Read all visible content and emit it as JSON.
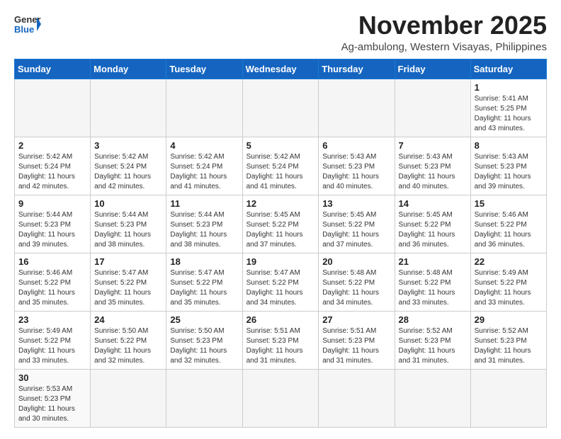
{
  "logo": {
    "text_general": "General",
    "text_blue": "Blue"
  },
  "header": {
    "month": "November 2025",
    "location": "Ag-ambulong, Western Visayas, Philippines"
  },
  "weekdays": [
    "Sunday",
    "Monday",
    "Tuesday",
    "Wednesday",
    "Thursday",
    "Friday",
    "Saturday"
  ],
  "weeks": [
    [
      {
        "day": null,
        "info": ""
      },
      {
        "day": null,
        "info": ""
      },
      {
        "day": null,
        "info": ""
      },
      {
        "day": null,
        "info": ""
      },
      {
        "day": null,
        "info": ""
      },
      {
        "day": null,
        "info": ""
      },
      {
        "day": "1",
        "info": "Sunrise: 5:41 AM\nSunset: 5:25 PM\nDaylight: 11 hours\nand 43 minutes."
      }
    ],
    [
      {
        "day": "2",
        "info": "Sunrise: 5:42 AM\nSunset: 5:24 PM\nDaylight: 11 hours\nand 42 minutes."
      },
      {
        "day": "3",
        "info": "Sunrise: 5:42 AM\nSunset: 5:24 PM\nDaylight: 11 hours\nand 42 minutes."
      },
      {
        "day": "4",
        "info": "Sunrise: 5:42 AM\nSunset: 5:24 PM\nDaylight: 11 hours\nand 41 minutes."
      },
      {
        "day": "5",
        "info": "Sunrise: 5:42 AM\nSunset: 5:24 PM\nDaylight: 11 hours\nand 41 minutes."
      },
      {
        "day": "6",
        "info": "Sunrise: 5:43 AM\nSunset: 5:23 PM\nDaylight: 11 hours\nand 40 minutes."
      },
      {
        "day": "7",
        "info": "Sunrise: 5:43 AM\nSunset: 5:23 PM\nDaylight: 11 hours\nand 40 minutes."
      },
      {
        "day": "8",
        "info": "Sunrise: 5:43 AM\nSunset: 5:23 PM\nDaylight: 11 hours\nand 39 minutes."
      }
    ],
    [
      {
        "day": "9",
        "info": "Sunrise: 5:44 AM\nSunset: 5:23 PM\nDaylight: 11 hours\nand 39 minutes."
      },
      {
        "day": "10",
        "info": "Sunrise: 5:44 AM\nSunset: 5:23 PM\nDaylight: 11 hours\nand 38 minutes."
      },
      {
        "day": "11",
        "info": "Sunrise: 5:44 AM\nSunset: 5:23 PM\nDaylight: 11 hours\nand 38 minutes."
      },
      {
        "day": "12",
        "info": "Sunrise: 5:45 AM\nSunset: 5:22 PM\nDaylight: 11 hours\nand 37 minutes."
      },
      {
        "day": "13",
        "info": "Sunrise: 5:45 AM\nSunset: 5:22 PM\nDaylight: 11 hours\nand 37 minutes."
      },
      {
        "day": "14",
        "info": "Sunrise: 5:45 AM\nSunset: 5:22 PM\nDaylight: 11 hours\nand 36 minutes."
      },
      {
        "day": "15",
        "info": "Sunrise: 5:46 AM\nSunset: 5:22 PM\nDaylight: 11 hours\nand 36 minutes."
      }
    ],
    [
      {
        "day": "16",
        "info": "Sunrise: 5:46 AM\nSunset: 5:22 PM\nDaylight: 11 hours\nand 35 minutes."
      },
      {
        "day": "17",
        "info": "Sunrise: 5:47 AM\nSunset: 5:22 PM\nDaylight: 11 hours\nand 35 minutes."
      },
      {
        "day": "18",
        "info": "Sunrise: 5:47 AM\nSunset: 5:22 PM\nDaylight: 11 hours\nand 35 minutes."
      },
      {
        "day": "19",
        "info": "Sunrise: 5:47 AM\nSunset: 5:22 PM\nDaylight: 11 hours\nand 34 minutes."
      },
      {
        "day": "20",
        "info": "Sunrise: 5:48 AM\nSunset: 5:22 PM\nDaylight: 11 hours\nand 34 minutes."
      },
      {
        "day": "21",
        "info": "Sunrise: 5:48 AM\nSunset: 5:22 PM\nDaylight: 11 hours\nand 33 minutes."
      },
      {
        "day": "22",
        "info": "Sunrise: 5:49 AM\nSunset: 5:22 PM\nDaylight: 11 hours\nand 33 minutes."
      }
    ],
    [
      {
        "day": "23",
        "info": "Sunrise: 5:49 AM\nSunset: 5:22 PM\nDaylight: 11 hours\nand 33 minutes."
      },
      {
        "day": "24",
        "info": "Sunrise: 5:50 AM\nSunset: 5:22 PM\nDaylight: 11 hours\nand 32 minutes."
      },
      {
        "day": "25",
        "info": "Sunrise: 5:50 AM\nSunset: 5:23 PM\nDaylight: 11 hours\nand 32 minutes."
      },
      {
        "day": "26",
        "info": "Sunrise: 5:51 AM\nSunset: 5:23 PM\nDaylight: 11 hours\nand 31 minutes."
      },
      {
        "day": "27",
        "info": "Sunrise: 5:51 AM\nSunset: 5:23 PM\nDaylight: 11 hours\nand 31 minutes."
      },
      {
        "day": "28",
        "info": "Sunrise: 5:52 AM\nSunset: 5:23 PM\nDaylight: 11 hours\nand 31 minutes."
      },
      {
        "day": "29",
        "info": "Sunrise: 5:52 AM\nSunset: 5:23 PM\nDaylight: 11 hours\nand 31 minutes."
      }
    ],
    [
      {
        "day": "30",
        "info": "Sunrise: 5:53 AM\nSunset: 5:23 PM\nDaylight: 11 hours\nand 30 minutes."
      },
      {
        "day": null,
        "info": ""
      },
      {
        "day": null,
        "info": ""
      },
      {
        "day": null,
        "info": ""
      },
      {
        "day": null,
        "info": ""
      },
      {
        "day": null,
        "info": ""
      },
      {
        "day": null,
        "info": ""
      }
    ]
  ]
}
